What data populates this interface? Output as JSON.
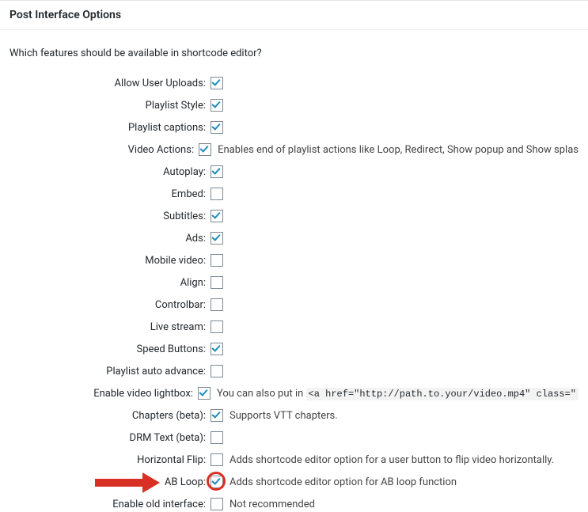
{
  "panel": {
    "title": "Post Interface Options",
    "description": "Which features should be available in shortcode editor?"
  },
  "options": [
    {
      "label": "Allow User Uploads:",
      "checked": true,
      "help": ""
    },
    {
      "label": "Playlist Style:",
      "checked": true,
      "help": ""
    },
    {
      "label": "Playlist captions:",
      "checked": true,
      "help": ""
    },
    {
      "label": "Video Actions:",
      "checked": true,
      "help": "Enables end of playlist actions like Loop, Redirect, Show popup and Show splas"
    },
    {
      "label": "Autoplay:",
      "checked": true,
      "help": ""
    },
    {
      "label": "Embed:",
      "checked": false,
      "help": ""
    },
    {
      "label": "Subtitles:",
      "checked": true,
      "help": ""
    },
    {
      "label": "Ads:",
      "checked": true,
      "help": ""
    },
    {
      "label": "Mobile video:",
      "checked": false,
      "help": ""
    },
    {
      "label": "Align:",
      "checked": false,
      "help": ""
    },
    {
      "label": "Controlbar:",
      "checked": false,
      "help": ""
    },
    {
      "label": "Live stream:",
      "checked": false,
      "help": ""
    },
    {
      "label": "Speed Buttons:",
      "checked": true,
      "help": ""
    },
    {
      "label": "Playlist auto advance:",
      "checked": false,
      "help": ""
    },
    {
      "label": "Enable video lightbox:",
      "checked": true,
      "help_prefix": "You can also put in ",
      "help_code": "<a href=\"http://path.to.your/video.mp4\" class=\""
    },
    {
      "label": "Chapters (beta):",
      "checked": true,
      "help": "Supports VTT chapters."
    },
    {
      "label": "DRM Text (beta):",
      "checked": false,
      "help": ""
    },
    {
      "label": "Horizontal Flip:",
      "checked": false,
      "help": "Adds shortcode editor option for a user button to flip video horizontally."
    },
    {
      "label": "AB Loop:",
      "checked": true,
      "help": "Adds shortcode editor option for AB loop function",
      "highlighted": true
    },
    {
      "label": "Enable old interface:",
      "checked": false,
      "help": "Not recommended"
    }
  ]
}
